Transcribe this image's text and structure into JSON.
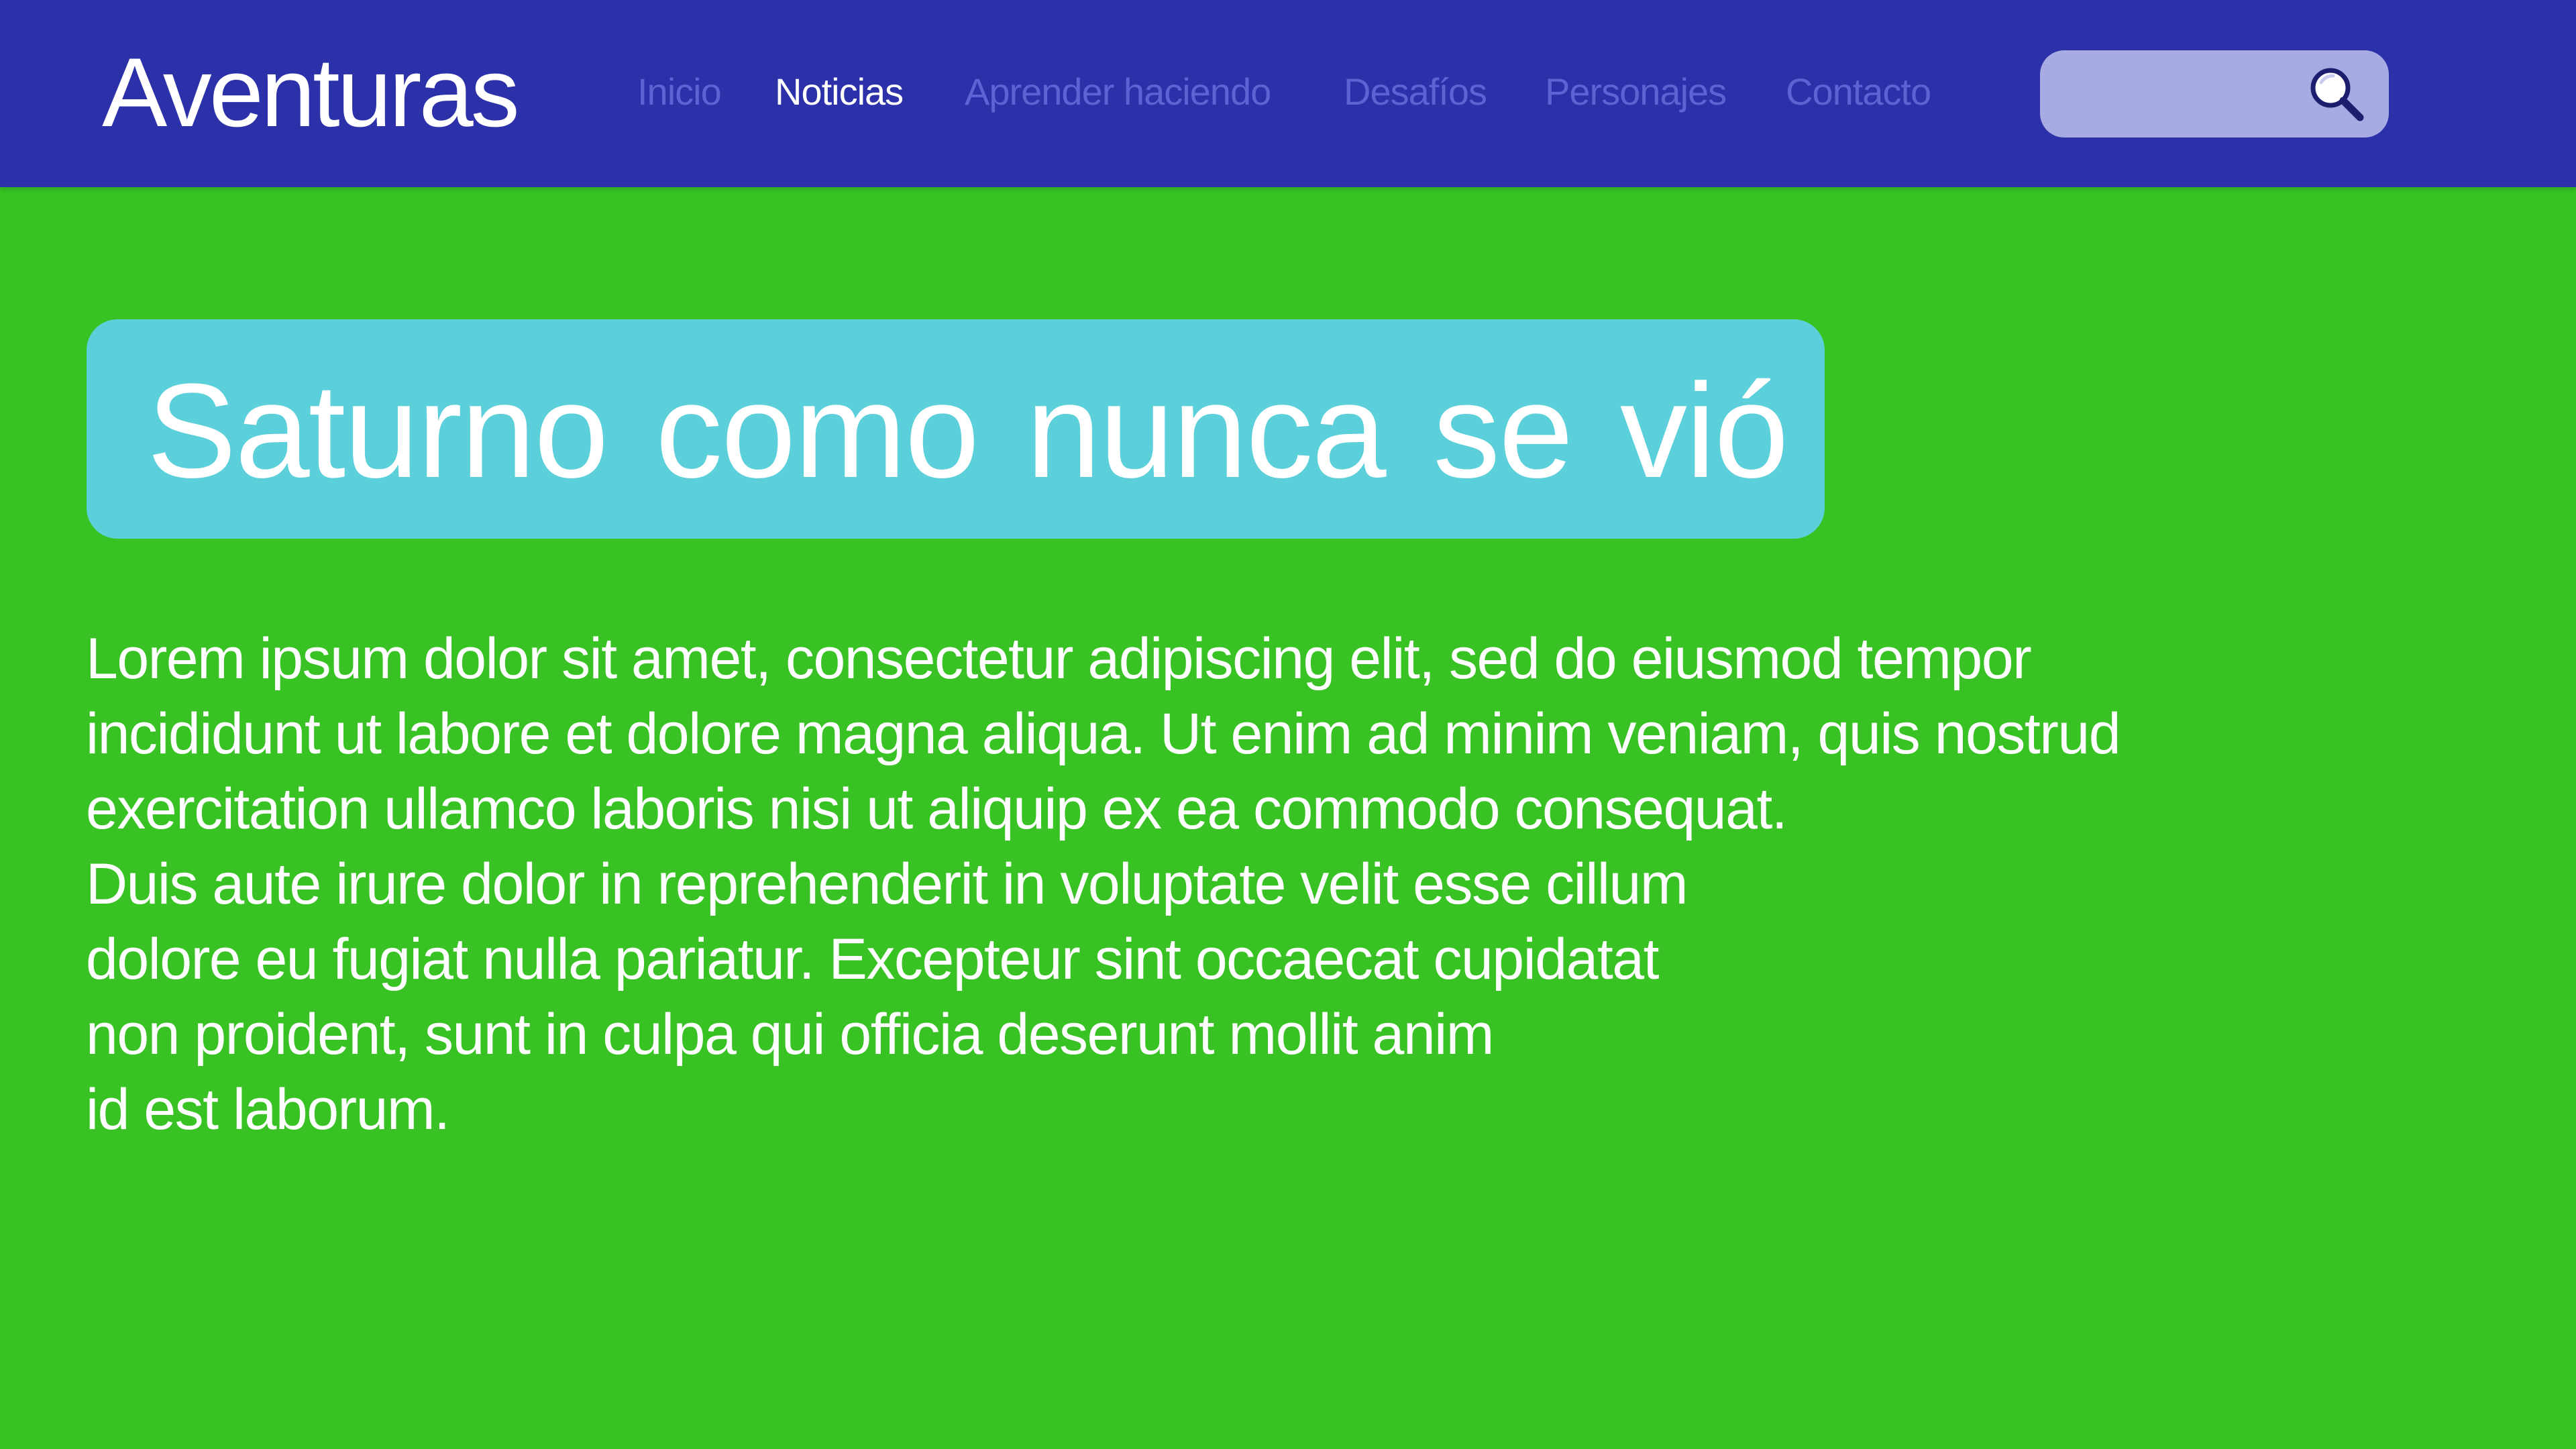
{
  "header": {
    "logo": "Aventuras",
    "nav": [
      {
        "label": "Inicio",
        "active": false
      },
      {
        "label": "Noticias",
        "active": true
      },
      {
        "label": "Aprender haciendo",
        "active": false
      },
      {
        "label": "Desafíos",
        "active": false
      },
      {
        "label": "Personajes",
        "active": false
      },
      {
        "label": "Contacto",
        "active": false
      }
    ],
    "search": {
      "value": "",
      "placeholder": "",
      "icon": "search-icon"
    }
  },
  "article": {
    "title": "Saturno como nunca se vió",
    "body_lines": [
      "Lorem ipsum dolor sit amet, consectetur adipiscing elit, sed do eiusmod tempor",
      "incididunt ut labore et dolore magna aliqua. Ut enim ad minim veniam, quis nostrud",
      "exercitation ullamco laboris nisi ut aliquip ex ea commodo consequat.",
      "Duis aute irure dolor in reprehenderit in voluptate velit esse cillum",
      "dolore eu fugiat nulla pariatur. Excepteur sint occaecat cupidatat",
      "non proident, sunt in culpa qui officia deserunt mollit anim",
      "id est laborum."
    ]
  },
  "colors": {
    "header_bg": "#2c31a9",
    "page_bg": "#38c224",
    "title_bg": "#5bd0da",
    "nav_inactive": "#5e63d4",
    "nav_active": "#ffffff",
    "search_bg": "#a8abe3"
  }
}
